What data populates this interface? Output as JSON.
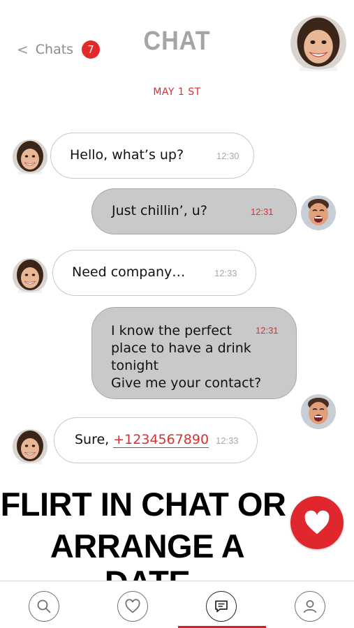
{
  "header": {
    "back_chevron": "<",
    "back_label": "Chats",
    "unread_count": "7",
    "title": "CHAT",
    "profile_avatar": "woman-avatar"
  },
  "date_separator": "MAY 1 ST",
  "messages": [
    {
      "direction": "incoming",
      "text": "Hello, what’s up?",
      "time": "12:30",
      "avatar": "woman-avatar"
    },
    {
      "direction": "outgoing",
      "text": "Just chillin’, u?",
      "time": "12:31",
      "avatar": "man-avatar"
    },
    {
      "direction": "incoming",
      "text": "Need company…",
      "time": "12:33",
      "avatar": "woman-avatar"
    },
    {
      "direction": "outgoing",
      "text": "I know the perfect\nplace to have a drink\ntonight\nGive me your contact?",
      "time": "12:31",
      "avatar": "man-avatar"
    },
    {
      "direction": "incoming",
      "text_prefix": "Sure, ",
      "phone": "+1234567890",
      "time": "12:33",
      "avatar": "woman-avatar"
    }
  ],
  "promo": {
    "line1": "FLIRT IN CHAT OR",
    "line2": "ARRANGE A DATE"
  },
  "fab_icon": "heart-icon",
  "tabs": [
    {
      "icon": "search-icon",
      "active": false
    },
    {
      "icon": "heart-outline-icon",
      "active": false
    },
    {
      "icon": "chat-icon",
      "active": true
    },
    {
      "icon": "profile-icon",
      "active": false
    }
  ],
  "colors": {
    "accent": "#d73030",
    "title_gray": "#a5a5a5",
    "incoming_bubble": "#ffffff",
    "outgoing_bubble": "#c9c9c9",
    "fab": "#e0272d"
  }
}
